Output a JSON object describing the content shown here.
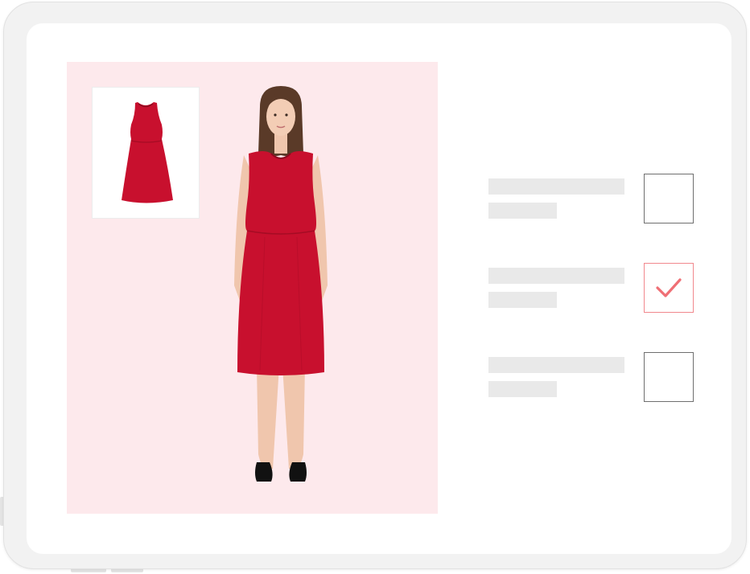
{
  "colors": {
    "panel_background": "#fde9ec",
    "dress_red": "#c8102e",
    "check_accent": "#ef6f75",
    "placeholder_bar": "#e9e9e9",
    "checkbox_border": "#6f6f6f"
  },
  "product": {
    "thumbnail_icon": "red-dress-icon",
    "model_image": "model-wearing-red-dress"
  },
  "options": [
    {
      "checked": false
    },
    {
      "checked": true
    },
    {
      "checked": false
    }
  ]
}
